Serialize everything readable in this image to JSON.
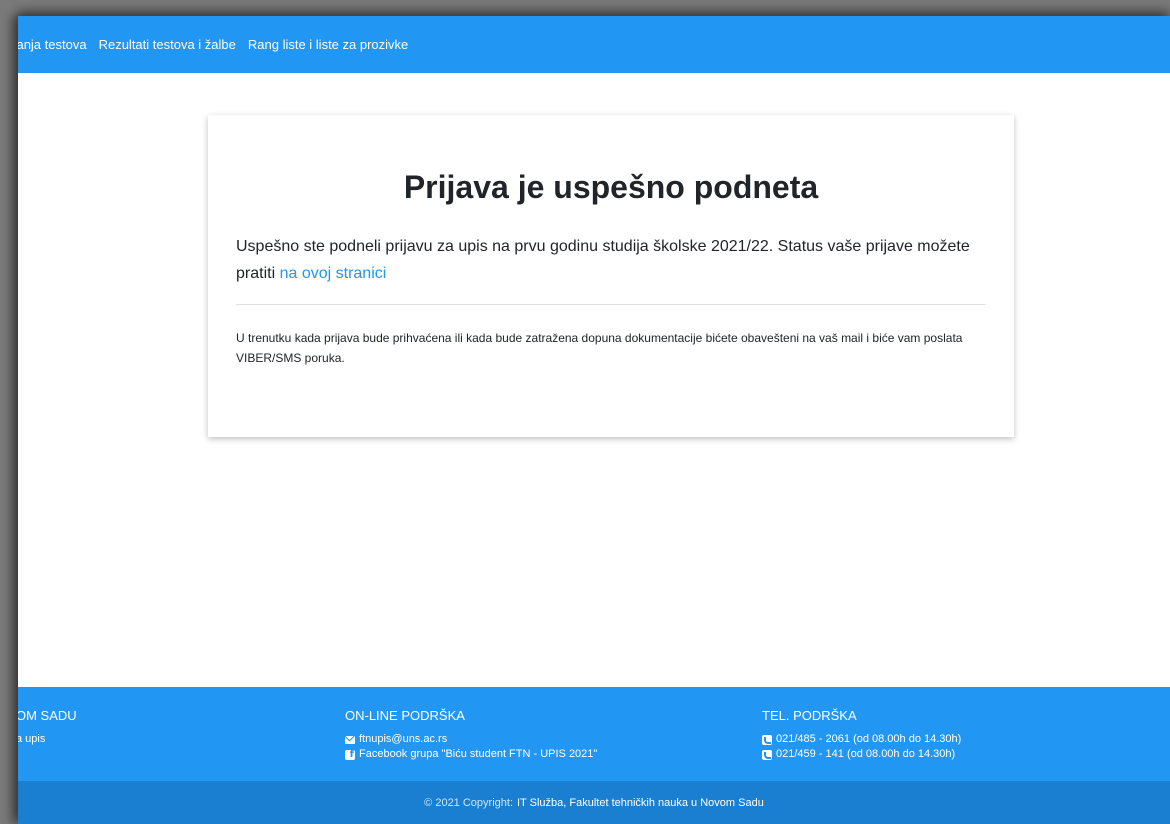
{
  "nav": {
    "items": [
      {
        "label": "aganja testova"
      },
      {
        "label": "Rezultati testova i žalbe"
      },
      {
        "label": "Rang liste i liste za prozivke"
      }
    ]
  },
  "card": {
    "title": "Prijava je uspešno podneta",
    "lead_text": "Uspešno ste podneli prijavu za upis na prvu godinu studija školske 2021/22. Status vaše prijave možete pratiti",
    "lead_link": "na ovoj stranici",
    "note": "U trenutku kada prijava bude prihvaćena ili kada bude zatražena dopuna dokumentacije bićete obavešteni na vaš mail i biće vam poslata VIBER/SMS poruka."
  },
  "footer": {
    "col1": {
      "heading": "OM SADU",
      "link": "a upis"
    },
    "col2": {
      "heading": "ON-LINE PODRŠKA",
      "email": "ftnupis@uns.ac.rs",
      "facebook": "Facebook grupa \"Biću student FTN - UPIS 2021\""
    },
    "col3": {
      "heading": "TEL. PODRŠKA",
      "phone1": "021/485 - 2061 (od 08.00h do 14.30h)",
      "phone2": "021/459 - 141 (od 08.00h do 14.30h)"
    }
  },
  "copyright": {
    "prefix": "© 2021 Copyright:",
    "owner": "IT Služba, Fakultet tehničkih nauka u Novom Sadu"
  },
  "colors": {
    "primary": "#2196f3",
    "footer_bottom": "#1a7fd1",
    "text": "#212529"
  },
  "icons": [
    "envelope-icon",
    "facebook-icon",
    "phone-icon"
  ]
}
